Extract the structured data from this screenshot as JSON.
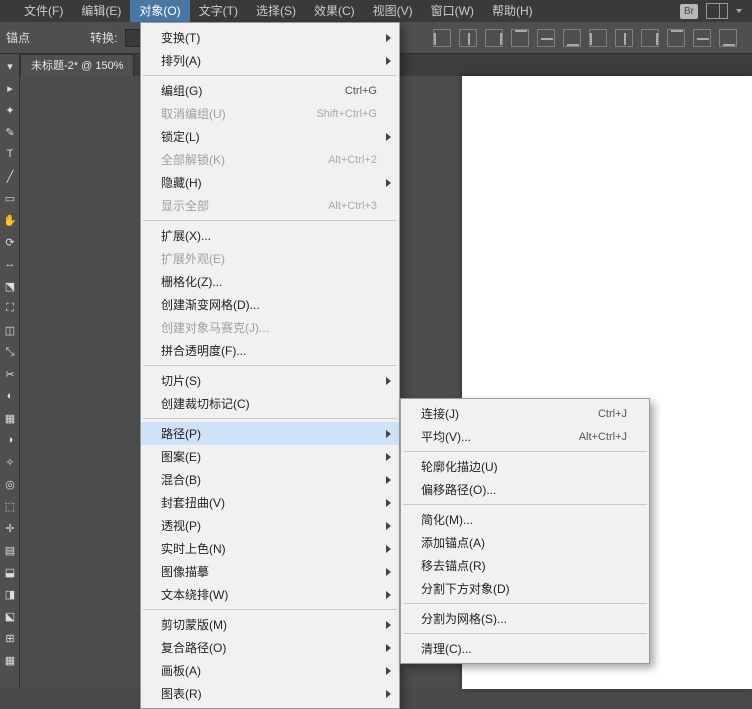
{
  "menubar": {
    "items": [
      {
        "label": "文件(F)"
      },
      {
        "label": "编辑(E)"
      },
      {
        "label": "对象(O)",
        "open": true
      },
      {
        "label": "文字(T)"
      },
      {
        "label": "选择(S)"
      },
      {
        "label": "效果(C)"
      },
      {
        "label": "视图(V)"
      },
      {
        "label": "窗口(W)"
      },
      {
        "label": "帮助(H)"
      }
    ],
    "br_label": "Br"
  },
  "controlbar": {
    "anchor_label": "锚点",
    "convert_label": "转换:"
  },
  "document": {
    "tab_label": "未标题-2* @ 150%"
  },
  "object_menu": {
    "items": [
      {
        "label": "变换(T)",
        "arrow": true
      },
      {
        "label": "排列(A)",
        "arrow": true
      },
      {
        "sep": true
      },
      {
        "label": "编组(G)",
        "accel": "Ctrl+G"
      },
      {
        "label": "取消编组(U)",
        "accel": "Shift+Ctrl+G",
        "disabled": true
      },
      {
        "label": "锁定(L)",
        "arrow": true
      },
      {
        "label": "全部解锁(K)",
        "accel": "Alt+Ctrl+2",
        "disabled": true
      },
      {
        "label": "隐藏(H)",
        "arrow": true
      },
      {
        "label": "显示全部",
        "accel": "Alt+Ctrl+3",
        "disabled": true
      },
      {
        "sep": true
      },
      {
        "label": "扩展(X)..."
      },
      {
        "label": "扩展外观(E)",
        "disabled": true
      },
      {
        "label": "栅格化(Z)..."
      },
      {
        "label": "创建渐变网格(D)..."
      },
      {
        "label": "创建对象马赛克(J)...",
        "disabled": true
      },
      {
        "label": "拼合透明度(F)..."
      },
      {
        "sep": true
      },
      {
        "label": "切片(S)",
        "arrow": true
      },
      {
        "label": "创建裁切标记(C)"
      },
      {
        "sep": true
      },
      {
        "label": "路径(P)",
        "arrow": true,
        "highlight": true
      },
      {
        "label": "图案(E)",
        "arrow": true
      },
      {
        "label": "混合(B)",
        "arrow": true
      },
      {
        "label": "封套扭曲(V)",
        "arrow": true
      },
      {
        "label": "透视(P)",
        "arrow": true
      },
      {
        "label": "实时上色(N)",
        "arrow": true
      },
      {
        "label": "图像描摹",
        "arrow": true
      },
      {
        "label": "文本绕排(W)",
        "arrow": true
      },
      {
        "sep": true
      },
      {
        "label": "剪切蒙版(M)",
        "arrow": true
      },
      {
        "label": "复合路径(O)",
        "arrow": true
      },
      {
        "label": "画板(A)",
        "arrow": true
      },
      {
        "label": "图表(R)",
        "arrow": true
      }
    ]
  },
  "path_submenu": {
    "items": [
      {
        "label": "连接(J)",
        "accel": "Ctrl+J"
      },
      {
        "label": "平均(V)...",
        "accel": "Alt+Ctrl+J"
      },
      {
        "sep": true
      },
      {
        "label": "轮廓化描边(U)"
      },
      {
        "label": "偏移路径(O)..."
      },
      {
        "sep": true
      },
      {
        "label": "简化(M)..."
      },
      {
        "label": "添加锚点(A)"
      },
      {
        "label": "移去锚点(R)"
      },
      {
        "label": "分割下方对象(D)"
      },
      {
        "sep": true
      },
      {
        "label": "分割为网格(S)..."
      },
      {
        "sep": true
      },
      {
        "label": "清理(C)..."
      }
    ]
  }
}
